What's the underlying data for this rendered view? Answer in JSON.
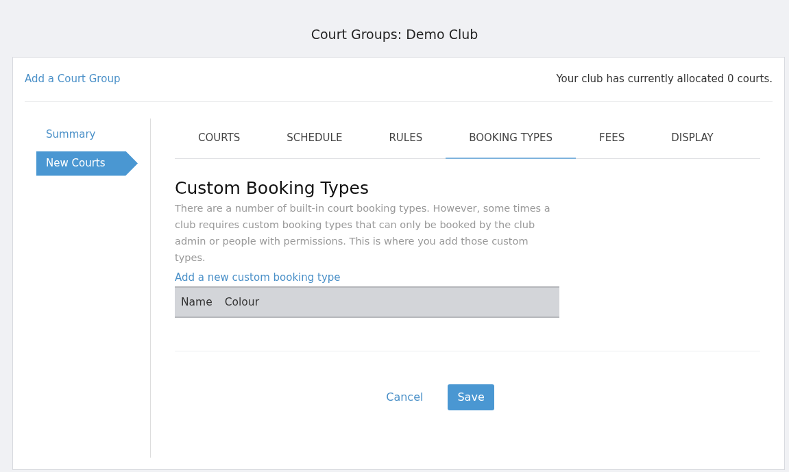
{
  "page_title": "Court Groups: Demo Club",
  "header": {
    "add_link": "Add a Court Group",
    "allocation_note": "Your club has currently allocated 0 courts."
  },
  "sidebar": {
    "items": [
      {
        "label": "Summary",
        "selected": false
      },
      {
        "label": "New Courts",
        "selected": true
      }
    ]
  },
  "tabs": [
    {
      "label": "COURTS",
      "selected": false
    },
    {
      "label": "SCHEDULE",
      "selected": false
    },
    {
      "label": "RULES",
      "selected": false
    },
    {
      "label": "BOOKING TYPES",
      "selected": true
    },
    {
      "label": "FEES",
      "selected": false
    },
    {
      "label": "DISPLAY",
      "selected": false
    }
  ],
  "section": {
    "heading": "Custom Booking Types",
    "description": "There are a number of built-in court booking types. However, some times a club requires custom booking types that can only be booked by the club admin or people with permissions. This is where you add those custom types.",
    "add_link": "Add a new custom booking type"
  },
  "table": {
    "columns": [
      "Name",
      "Colour"
    ]
  },
  "buttons": {
    "cancel": "Cancel",
    "save": "Save"
  }
}
